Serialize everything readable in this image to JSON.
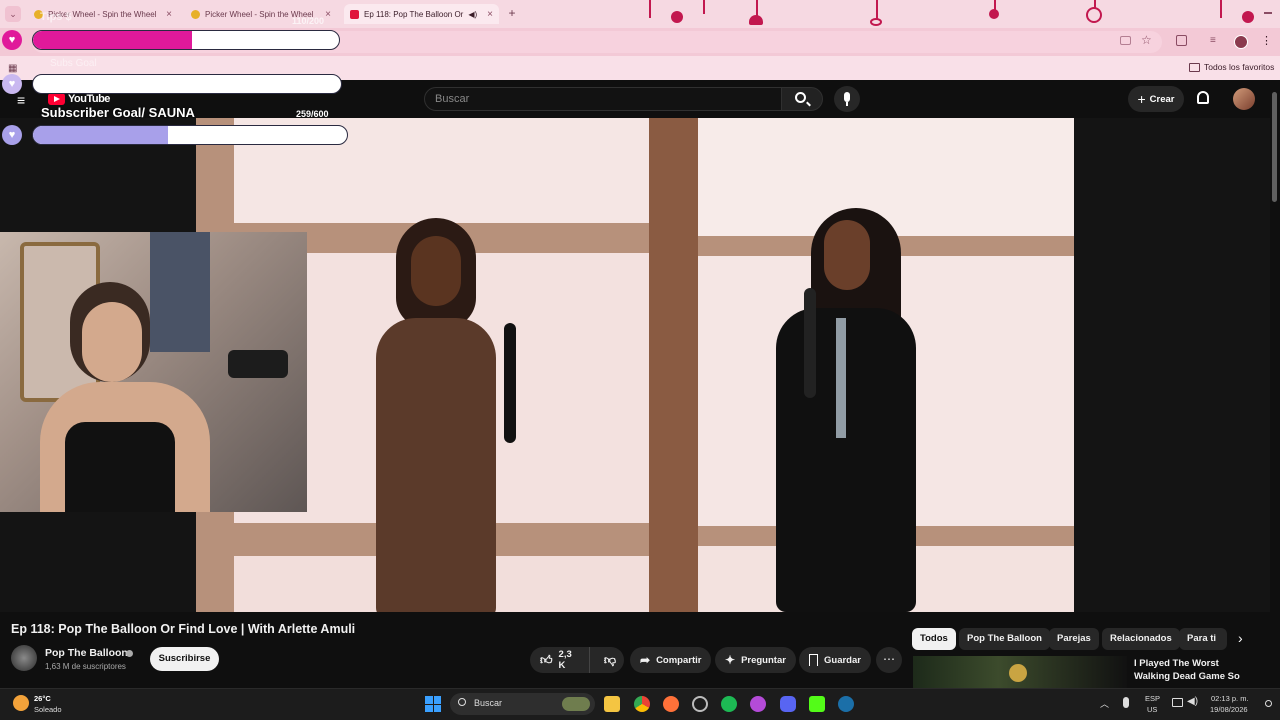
{
  "browser": {
    "tabs": [
      {
        "title": "Picker Wheel - Spin the Wheel",
        "active": false
      },
      {
        "title": "Picker Wheel - Spin the Wheel",
        "active": false
      },
      {
        "title": "Ep 118: Pop The Balloon Or",
        "active": true
      }
    ],
    "new_tab": "+",
    "bookmarks_folder": "Todos los favoritos",
    "accent": "#f3c9d6"
  },
  "youtube": {
    "logo": "YouTube",
    "search_placeholder": "Buscar",
    "create_label": "Crear",
    "video_title": "Ep 118: Pop The Balloon Or Find Love | With Arlette Amuli",
    "channel_name": "Pop The Balloon",
    "subscribers": "1,63 M de suscriptores",
    "subscribe_label": "Suscribirse",
    "likes": "2,3 K",
    "share_label": "Compartir",
    "ask_label": "Preguntar",
    "save_label": "Guardar",
    "chips": [
      "Todos",
      "Pop The Balloon",
      "Parejas",
      "Relacionados",
      "Para ti"
    ],
    "recommended_title": "I Played The Worst Walking Dead Game So You Don't"
  },
  "overlay": {
    "goal_top_label": "Tips $",
    "goal_top_count": "110/200",
    "goal_top_progress": 0.52,
    "goal_mid_label": "Subs Goal",
    "goal_sub_label": "Subscriber Goal/ SAUNA",
    "goal_sub_count": "259/600",
    "goal_sub_progress": 0.43,
    "pink": "#e0199a",
    "lavender": "#a8a0ea"
  },
  "taskbar": {
    "temperature": "26°C",
    "weather": "Soleado",
    "search_placeholder": "Buscar",
    "lang_top": "ESP",
    "lang_bottom": "US",
    "time": "02:13 p. m.",
    "date": "19/08/2026"
  }
}
